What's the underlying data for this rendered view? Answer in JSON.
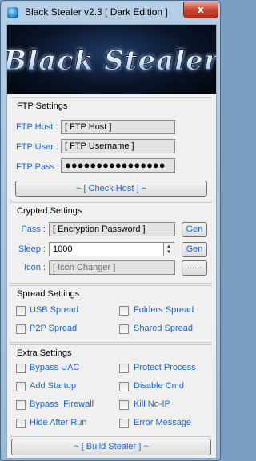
{
  "window": {
    "title": "Black Stealer v2.3 [ Dark Edition ]",
    "close_glyph": "x"
  },
  "banner": {
    "logo_text": "Black Stealer"
  },
  "ftp": {
    "section_title": "FTP Settings",
    "host_label": "FTP Host :",
    "host_value": "[ FTP Host ]",
    "user_label": "FTP User :",
    "user_value": "[ FTP Username ]",
    "pass_label": "FTP Pass :",
    "pass_value": "●●●●●●●●●●●●●●●●",
    "check_button": "~ [ Check Host ] ~"
  },
  "crypted": {
    "section_title": "Crypted Settings",
    "pass_label": "Pass :",
    "pass_value": "[ Encryption Password ]",
    "pass_gen": "Gen",
    "sleep_label": "Sleep :",
    "sleep_value": "1000",
    "sleep_gen": "Gen",
    "icon_label": "Icon :",
    "icon_value": "[ Icon Changer ]",
    "icon_browse": "......"
  },
  "spread": {
    "section_title": "Spread Settings",
    "options": [
      "USB Spread",
      "Folders Spread",
      "P2P Spread",
      "Shared Spread"
    ]
  },
  "extra": {
    "section_title": "Extra Settings",
    "options": [
      "Bypass UAC",
      "Protect Process",
      "Add Startup",
      "Disable Cmd",
      "Bypass  Firewall",
      "Kill No-IP",
      "Hide After Run",
      "Error Message"
    ]
  },
  "build_button": "~ [ Build Stealer ] ~",
  "colors": {
    "label": "#1a66d0",
    "banner_bg": "#0a1428",
    "close": "#c7432e"
  },
  "icons": [
    "app-icon",
    "close-icon"
  ]
}
